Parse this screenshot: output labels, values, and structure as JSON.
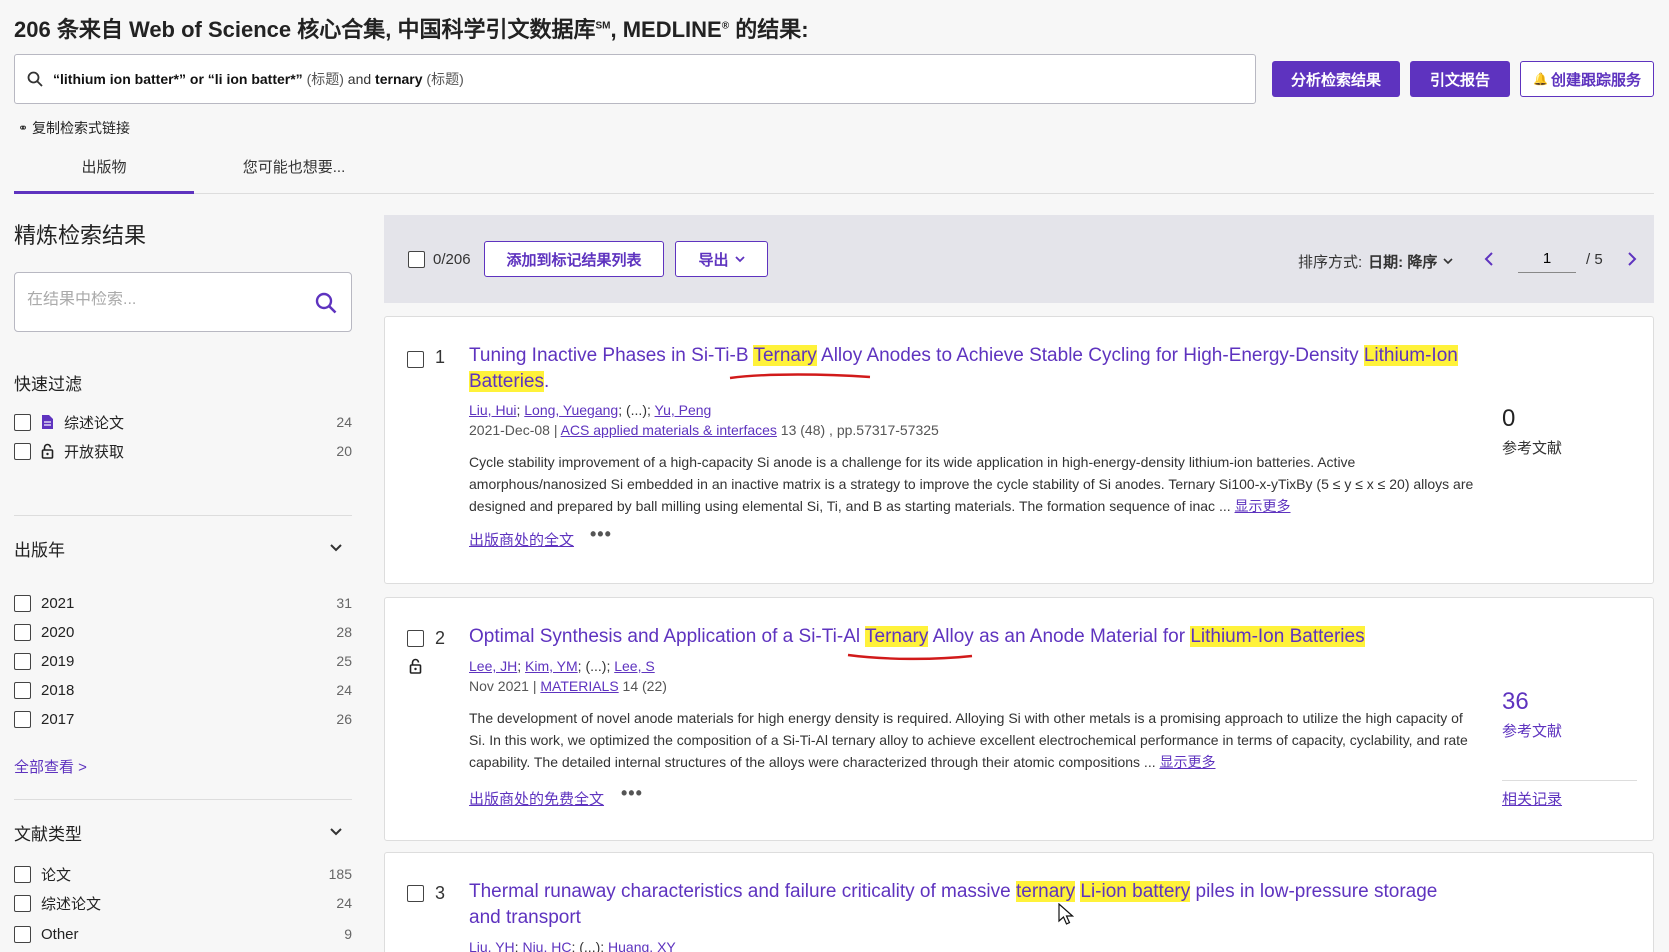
{
  "header": {
    "count": "206",
    "title_rest": "条来自 Web of Science 核心合集, 中国科学引文数据库",
    "title_sm": "SM",
    "title_mid": ", MEDLINE",
    "title_reg": "®",
    "title_end": " 的结果:"
  },
  "query": {
    "term1": "“lithium ion batter*” or “li ion batter*”",
    "field1": " (标题) ",
    "op": "and ",
    "term2": "ternary",
    "field2": " (标题)"
  },
  "actions": {
    "analyze": "分析检索结果",
    "citation_report": "引文报告",
    "create_alert": "创建跟踪服务"
  },
  "copy_link": "复制检索式链接",
  "tabs": [
    "出版物",
    "您可能也想要..."
  ],
  "sidebar": {
    "title": "精炼检索结果",
    "search_placeholder": "在结果中检索...",
    "quick_filter": {
      "title": "快速过滤",
      "items": [
        {
          "label": "综述论文",
          "count": "24",
          "icon": "document-icon"
        },
        {
          "label": "开放获取",
          "count": "20",
          "icon": "lock-open-icon"
        }
      ]
    },
    "year": {
      "title": "出版年",
      "items": [
        {
          "label": "2021",
          "count": "31"
        },
        {
          "label": "2020",
          "count": "28"
        },
        {
          "label": "2019",
          "count": "25"
        },
        {
          "label": "2018",
          "count": "24"
        },
        {
          "label": "2017",
          "count": "26"
        }
      ],
      "see_all": "全部查看 >"
    },
    "doctype": {
      "title": "文献类型",
      "items": [
        {
          "label": "论文",
          "count": "185"
        },
        {
          "label": "综述论文",
          "count": "24"
        },
        {
          "label": "Other",
          "count": "9"
        }
      ]
    }
  },
  "toolbar": {
    "selected": "0/206",
    "add_to_marked": "添加到标记结果列表",
    "export": "导出",
    "sort_label": "排序方式:",
    "sort_value": "日期: 降序",
    "page": "1",
    "total_pages": "/ 5"
  },
  "results": [
    {
      "num": "1",
      "title_parts": [
        "Tuning Inactive Phases in Si-Ti-B ",
        "Ternary",
        " Alloy Anodes to Achieve Stable Cycling for High-Energy-Density ",
        "Lithium-Ion Batteries",
        "."
      ],
      "authors": [
        "Liu, Hui",
        "Long, Yuegang",
        "(...)",
        "Yu, Peng"
      ],
      "date": "2021-Dec-08 | ",
      "journal": "ACS applied materials & interfaces",
      "volume": " 13 (48) , pp.57317-57325",
      "abstract": "Cycle stability improvement of a high-capacity Si anode is a challenge for its wide application in high-energy-density lithium-ion batteries. Active amorphous/nanosized Si embedded in an inactive matrix is a strategy to improve the cycle stability of Si anodes. Ternary Si100-x-yTixBy (5 ≤ y ≤ x ≤ 20) alloys are designed and prepared by ball milling using elemental Si, Ti, and B as starting materials. The formation sequence of inac ... ",
      "show_more": "显示更多",
      "fulltext": "出版商处的全文",
      "refs": "0",
      "refs_label": "参考文献"
    },
    {
      "num": "2",
      "title_parts": [
        "Optimal Synthesis and Application of a Si-Ti-Al ",
        "Ternary",
        " Alloy as an Anode Material for ",
        "Lithium-Ion Batteries",
        ""
      ],
      "authors": [
        "Lee, JH",
        "Kim, YM",
        "(...)",
        "Lee, S"
      ],
      "date": "Nov 2021 | ",
      "journal": "MATERIALS",
      "volume": " 14 (22)",
      "abstract": "The development of novel anode materials for high energy density is required. Alloying Si with other metals is a promising approach to utilize the high capacity of Si. In this work, we optimized the composition of a Si-Ti-Al ternary alloy to achieve excellent electrochemical performance in terms of capacity, cyclability, and rate capability. The detailed internal structures of the alloys were characterized through their atomic compositions ... ",
      "show_more": "显示更多",
      "fulltext": "出版商处的免费全文",
      "refs": "36",
      "refs_label": "参考文献",
      "related": "相关记录"
    },
    {
      "num": "3",
      "title_parts": [
        "Thermal runaway characteristics and failure criticality of massive ",
        "ternary",
        " ",
        "Li-ion battery",
        " piles in low-pressure storage and transport"
      ],
      "authors": [
        "Liu, YH",
        "Niu, HC",
        "(...)",
        "Huang, XY"
      ]
    }
  ],
  "colors": {
    "accent": "#5e33bf",
    "highlight": "#fff23a",
    "annotation": "#d11a1a"
  }
}
